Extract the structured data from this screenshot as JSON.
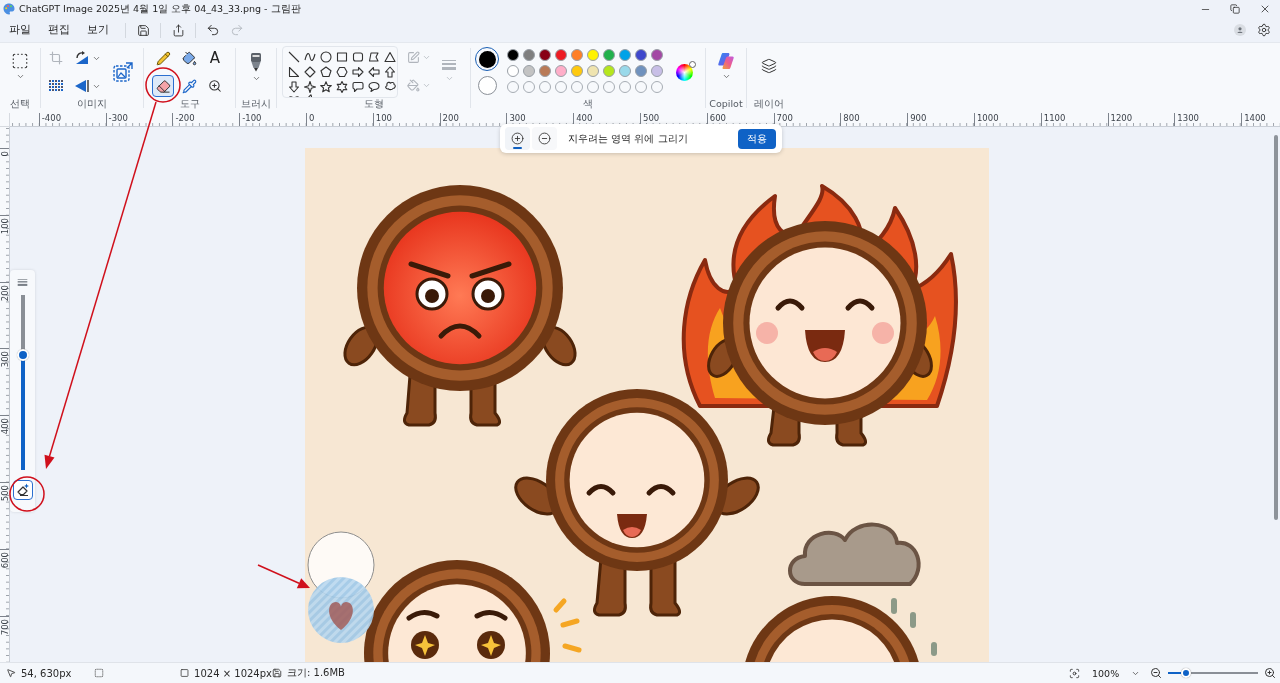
{
  "window": {
    "title": "ChatGPT Image 2025년 4월 1일 오후 04_43_33.png - 그림판"
  },
  "menu": [
    {
      "label": "파일"
    },
    {
      "label": "편집"
    },
    {
      "label": "보기"
    }
  ],
  "quick_actions": [
    {
      "kind": "save",
      "disabled": false
    },
    {
      "kind": "share",
      "disabled": false
    },
    {
      "kind": "undo",
      "disabled": false
    },
    {
      "kind": "redo",
      "disabled": true
    }
  ],
  "ribbon": {
    "groups": [
      {
        "kind": "selection",
        "label": "선택"
      },
      {
        "kind": "image",
        "label": "이미지",
        "actions": [
          {
            "kind": "crop",
            "disabled": true,
            "dropdown": false
          },
          {
            "kind": "rotate",
            "disabled": false,
            "dropdown": true
          },
          {
            "kind": "resize",
            "disabled": false,
            "dropdown": false
          },
          {
            "kind": "flip",
            "disabled": false,
            "dropdown": true
          },
          {
            "kind": "remove_background",
            "disabled": false,
            "dropdown": false
          }
        ]
      },
      {
        "kind": "tools",
        "label": "도구",
        "tools": [
          {
            "kind": "pencil",
            "selected": false
          },
          {
            "kind": "fill",
            "selected": false
          },
          {
            "kind": "text",
            "label": "A",
            "selected": false
          },
          {
            "kind": "eraser",
            "selected": true
          },
          {
            "kind": "picker",
            "selected": false
          },
          {
            "kind": "magnifier",
            "selected": false
          }
        ]
      },
      {
        "kind": "brushes",
        "label": "브러시"
      },
      {
        "kind": "shapes",
        "label": "도형",
        "options": [
          {
            "kind": "outline",
            "disabled": true
          },
          {
            "kind": "fill",
            "disabled": true
          },
          {
            "kind": "size",
            "disabled": true
          }
        ]
      },
      {
        "kind": "colors",
        "label": "색",
        "primary": {
          "color": "#000000",
          "selected": true
        },
        "secondary": {
          "color": "#ffffff",
          "selected": false
        },
        "palette": [
          {
            "color": "#000000"
          },
          {
            "color": "#7f7f7f"
          },
          {
            "color": "#880015"
          },
          {
            "color": "#ed1c24"
          },
          {
            "color": "#ff7f27"
          },
          {
            "color": "#fff200"
          },
          {
            "color": "#22b14c"
          },
          {
            "color": "#00a2e8"
          },
          {
            "color": "#3f48cc"
          },
          {
            "color": "#a349a4"
          },
          {
            "color": "#ffffff"
          },
          {
            "color": "#c3c3c3"
          },
          {
            "color": "#b97a57"
          },
          {
            "color": "#ffaec9"
          },
          {
            "color": "#ffc90e"
          },
          {
            "color": "#efe4b0"
          },
          {
            "color": "#b5e61d"
          },
          {
            "color": "#99d9ea"
          },
          {
            "color": "#7092be"
          },
          {
            "color": "#c8bfe7"
          }
        ]
      },
      {
        "kind": "copilot",
        "label": "Copilot"
      },
      {
        "kind": "layers",
        "label": "레이어"
      }
    ]
  },
  "ruler": {
    "horizontal": [
      "-400",
      "-300",
      "-200",
      "-100",
      "0",
      "100",
      "200",
      "300",
      "400",
      "500",
      "600",
      "700",
      "800",
      "900",
      "1000",
      "1100",
      "1200",
      "1300",
      "1400"
    ],
    "vertical": [
      "0",
      "100",
      "200",
      "300",
      "400",
      "500",
      "600",
      "700"
    ]
  },
  "eraser_bar": {
    "modes": [
      {
        "kind": "add",
        "selected": true
      },
      {
        "kind": "subtract",
        "selected": false
      }
    ],
    "hint": "지우려는 영역 위에 그리기",
    "apply_button": "적용"
  },
  "size_panel": {
    "level": 0.66,
    "mode_button": {
      "selected": true
    }
  },
  "status_bar": {
    "cursor": "54, 630px",
    "dimensions": "1024 × 1024px",
    "file_size": "크기: 1.6MB",
    "zoom": "100%",
    "zoom_slider": {
      "level": 0.2
    }
  }
}
